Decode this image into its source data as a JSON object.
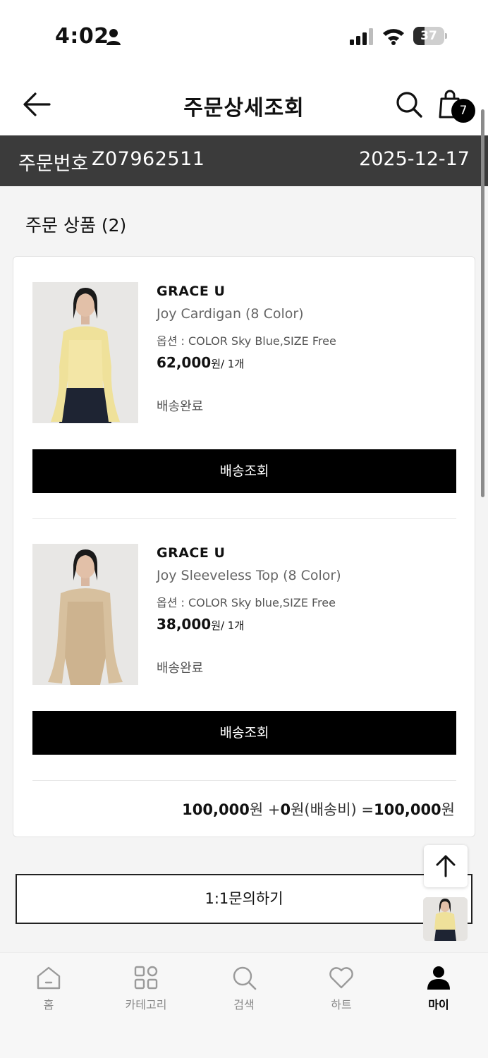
{
  "status_bar": {
    "time": "4:02",
    "battery": "37"
  },
  "header": {
    "title": "주문상세조회",
    "cart_count": "7"
  },
  "order": {
    "number_label": "주문번호",
    "number": "Z07962511",
    "date": "2025-12-17"
  },
  "section_title": "주문 상품 (2)",
  "items": [
    {
      "brand": "GRACE U",
      "name": "Joy Cardigan (8 Color)",
      "option": "옵션 : COLOR Sky Blue,SIZE Free",
      "price": "62,000",
      "qty": "원/ 1개",
      "status": "배송완료",
      "button": "배송조회"
    },
    {
      "brand": "GRACE U",
      "name": "Joy Sleeveless Top (8 Color)",
      "option": "옵션 : COLOR Sky blue,SIZE Free",
      "price": "38,000",
      "qty": "원/ 1개",
      "status": "배송완료",
      "button": "배송조회"
    }
  ],
  "total": {
    "product_amount": "100,000",
    "won": "원",
    "shipping_prefix": "+",
    "shipping_amount": "0",
    "shipping_label": "원(배송비) =",
    "grand_total": "100,000",
    "grand_won": "원"
  },
  "inquiry_button": "1:1문의하기",
  "nav": [
    {
      "label": "홈",
      "icon": "home-icon"
    },
    {
      "label": "카테고리",
      "icon": "category-icon"
    },
    {
      "label": "검색",
      "icon": "search-icon"
    },
    {
      "label": "하트",
      "icon": "heart-icon"
    },
    {
      "label": "마이",
      "icon": "user-icon"
    }
  ]
}
